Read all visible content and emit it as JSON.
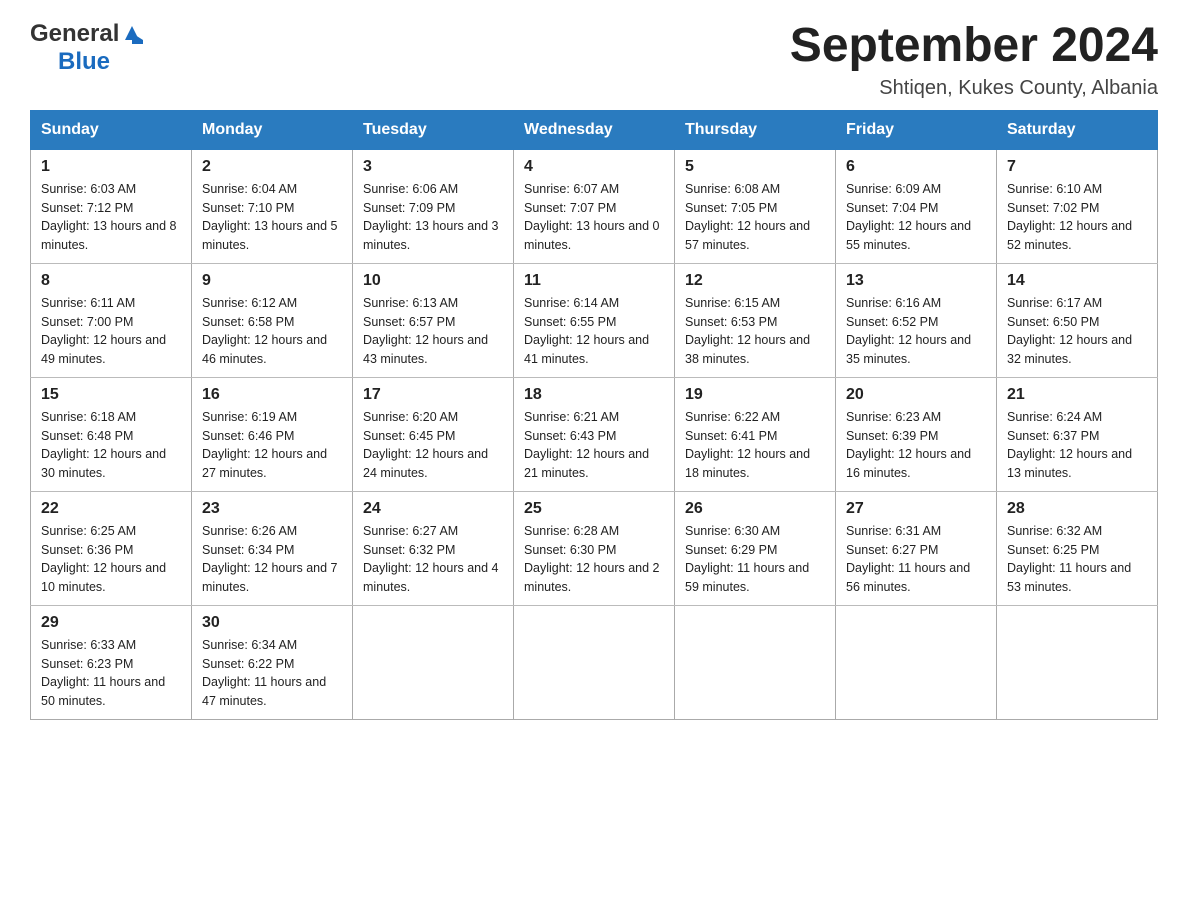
{
  "logo": {
    "general": "General",
    "blue": "Blue"
  },
  "title": "September 2024",
  "subtitle": "Shtiqen, Kukes County, Albania",
  "days_header": [
    "Sunday",
    "Monday",
    "Tuesday",
    "Wednesday",
    "Thursday",
    "Friday",
    "Saturday"
  ],
  "weeks": [
    [
      {
        "day": "1",
        "sunrise": "6:03 AM",
        "sunset": "7:12 PM",
        "daylight": "13 hours and 8 minutes."
      },
      {
        "day": "2",
        "sunrise": "6:04 AM",
        "sunset": "7:10 PM",
        "daylight": "13 hours and 5 minutes."
      },
      {
        "day": "3",
        "sunrise": "6:06 AM",
        "sunset": "7:09 PM",
        "daylight": "13 hours and 3 minutes."
      },
      {
        "day": "4",
        "sunrise": "6:07 AM",
        "sunset": "7:07 PM",
        "daylight": "13 hours and 0 minutes."
      },
      {
        "day": "5",
        "sunrise": "6:08 AM",
        "sunset": "7:05 PM",
        "daylight": "12 hours and 57 minutes."
      },
      {
        "day": "6",
        "sunrise": "6:09 AM",
        "sunset": "7:04 PM",
        "daylight": "12 hours and 55 minutes."
      },
      {
        "day": "7",
        "sunrise": "6:10 AM",
        "sunset": "7:02 PM",
        "daylight": "12 hours and 52 minutes."
      }
    ],
    [
      {
        "day": "8",
        "sunrise": "6:11 AM",
        "sunset": "7:00 PM",
        "daylight": "12 hours and 49 minutes."
      },
      {
        "day": "9",
        "sunrise": "6:12 AM",
        "sunset": "6:58 PM",
        "daylight": "12 hours and 46 minutes."
      },
      {
        "day": "10",
        "sunrise": "6:13 AM",
        "sunset": "6:57 PM",
        "daylight": "12 hours and 43 minutes."
      },
      {
        "day": "11",
        "sunrise": "6:14 AM",
        "sunset": "6:55 PM",
        "daylight": "12 hours and 41 minutes."
      },
      {
        "day": "12",
        "sunrise": "6:15 AM",
        "sunset": "6:53 PM",
        "daylight": "12 hours and 38 minutes."
      },
      {
        "day": "13",
        "sunrise": "6:16 AM",
        "sunset": "6:52 PM",
        "daylight": "12 hours and 35 minutes."
      },
      {
        "day": "14",
        "sunrise": "6:17 AM",
        "sunset": "6:50 PM",
        "daylight": "12 hours and 32 minutes."
      }
    ],
    [
      {
        "day": "15",
        "sunrise": "6:18 AM",
        "sunset": "6:48 PM",
        "daylight": "12 hours and 30 minutes."
      },
      {
        "day": "16",
        "sunrise": "6:19 AM",
        "sunset": "6:46 PM",
        "daylight": "12 hours and 27 minutes."
      },
      {
        "day": "17",
        "sunrise": "6:20 AM",
        "sunset": "6:45 PM",
        "daylight": "12 hours and 24 minutes."
      },
      {
        "day": "18",
        "sunrise": "6:21 AM",
        "sunset": "6:43 PM",
        "daylight": "12 hours and 21 minutes."
      },
      {
        "day": "19",
        "sunrise": "6:22 AM",
        "sunset": "6:41 PM",
        "daylight": "12 hours and 18 minutes."
      },
      {
        "day": "20",
        "sunrise": "6:23 AM",
        "sunset": "6:39 PM",
        "daylight": "12 hours and 16 minutes."
      },
      {
        "day": "21",
        "sunrise": "6:24 AM",
        "sunset": "6:37 PM",
        "daylight": "12 hours and 13 minutes."
      }
    ],
    [
      {
        "day": "22",
        "sunrise": "6:25 AM",
        "sunset": "6:36 PM",
        "daylight": "12 hours and 10 minutes."
      },
      {
        "day": "23",
        "sunrise": "6:26 AM",
        "sunset": "6:34 PM",
        "daylight": "12 hours and 7 minutes."
      },
      {
        "day": "24",
        "sunrise": "6:27 AM",
        "sunset": "6:32 PM",
        "daylight": "12 hours and 4 minutes."
      },
      {
        "day": "25",
        "sunrise": "6:28 AM",
        "sunset": "6:30 PM",
        "daylight": "12 hours and 2 minutes."
      },
      {
        "day": "26",
        "sunrise": "6:30 AM",
        "sunset": "6:29 PM",
        "daylight": "11 hours and 59 minutes."
      },
      {
        "day": "27",
        "sunrise": "6:31 AM",
        "sunset": "6:27 PM",
        "daylight": "11 hours and 56 minutes."
      },
      {
        "day": "28",
        "sunrise": "6:32 AM",
        "sunset": "6:25 PM",
        "daylight": "11 hours and 53 minutes."
      }
    ],
    [
      {
        "day": "29",
        "sunrise": "6:33 AM",
        "sunset": "6:23 PM",
        "daylight": "11 hours and 50 minutes."
      },
      {
        "day": "30",
        "sunrise": "6:34 AM",
        "sunset": "6:22 PM",
        "daylight": "11 hours and 47 minutes."
      },
      null,
      null,
      null,
      null,
      null
    ]
  ],
  "labels": {
    "sunrise": "Sunrise:",
    "sunset": "Sunset:",
    "daylight": "Daylight:"
  }
}
